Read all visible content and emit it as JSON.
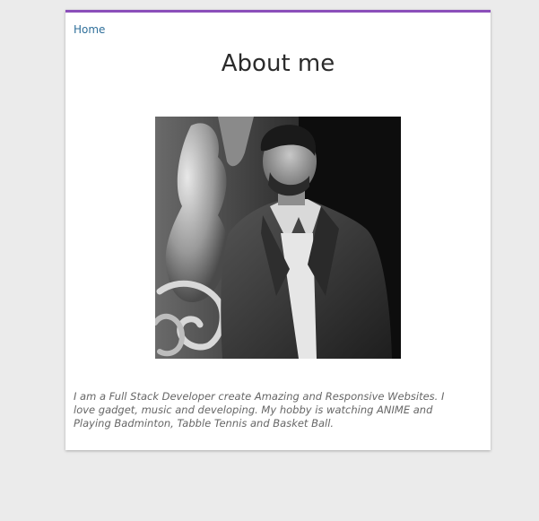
{
  "breadcrumb": {
    "home_label": "Home"
  },
  "page": {
    "title": "About me"
  },
  "bio": {
    "text": "I am a Full Stack Developer create Amazing and Responsive Websites. I love gadget, music and developing. My hobby is watching ANIME and Playing Badminton, Tabble Tennis and Basket Ball."
  },
  "colors": {
    "accent": "#8b4fba",
    "link": "#2f6f9a",
    "background": "#ebebeb",
    "card": "#ffffff"
  }
}
